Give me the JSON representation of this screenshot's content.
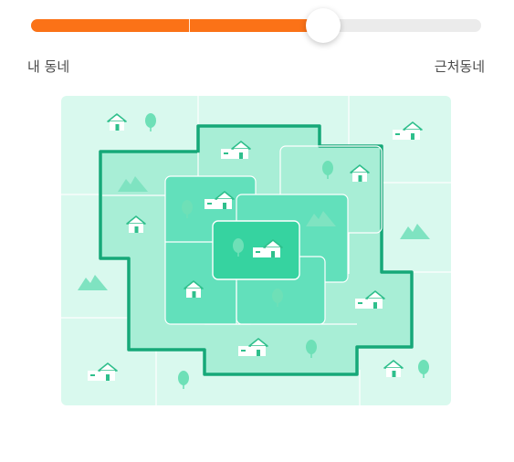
{
  "range_slider": {
    "level": 0.65,
    "step_ticks": [
      0.35,
      0.65
    ],
    "colors": {
      "fill": "#fb7217",
      "track": "#ebebeb",
      "thumb": "#ffffff"
    },
    "labels": {
      "min": "내 동네",
      "max": "근처동네"
    }
  },
  "map": {
    "colors": {
      "outer": "#d9f9ee",
      "ring2": "#a8eed6",
      "ring1": "#62e0bb",
      "center": "#36d3a0",
      "border": "#16a878",
      "icon": "#2fbf8c"
    }
  }
}
